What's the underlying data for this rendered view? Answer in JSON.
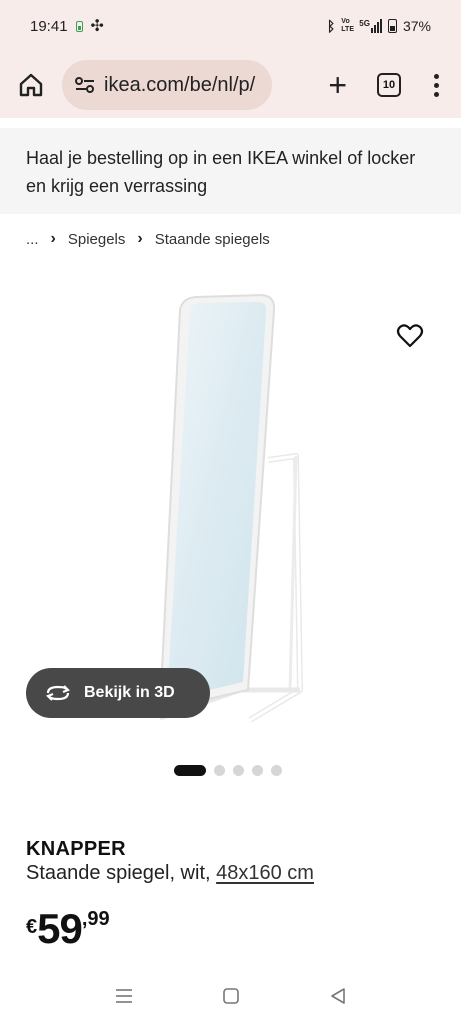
{
  "status_bar": {
    "time": "19:41",
    "battery": "37%",
    "network": "5G",
    "volte": "Vo LTE"
  },
  "browser": {
    "url": "ikea.com/be/nl/p/",
    "tab_count": "10",
    "icons": {
      "home": "home-icon",
      "site_info": "tune-icon",
      "new_tab": "plus-icon",
      "tabs": "tab-switcher-icon",
      "menu": "kebab-menu-icon"
    }
  },
  "banner": {
    "text": "Haal je bestelling op in een IKEA winkel of locker en krijg een verrassing"
  },
  "breadcrumb": {
    "ellipsis": "...",
    "items": [
      "Spiegels",
      "Staande spiegels"
    ]
  },
  "product": {
    "view_3d_label": "Bekijk in 3D",
    "image_count": 5,
    "active_image": 1,
    "name": "KNAPPER",
    "description": "Staande spiegel, wit,",
    "size": "48x160 cm",
    "price": {
      "currency": "€",
      "integer": "59",
      "decimal": ",99"
    }
  },
  "colors": {
    "chrome_bg": "#f7ecea",
    "url_pill": "#ecd9d4",
    "banner_bg": "#f5f5f5",
    "button_3d": "#484848",
    "text": "#111111"
  }
}
